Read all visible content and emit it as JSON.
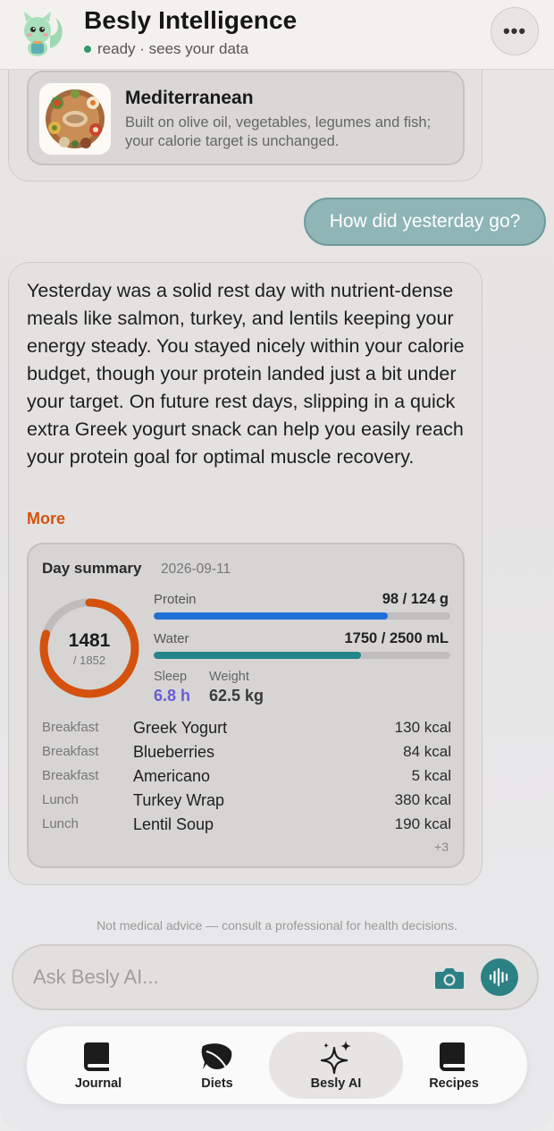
{
  "header": {
    "title": "Besly Intelligence",
    "status": "ready · sees your data",
    "menu_icon": "ellipsis-icon"
  },
  "diet_card": {
    "title": "Mediterranean",
    "description": "Built on olive oil, vegetables, legumes and fish; your calorie target is unchanged."
  },
  "user_message": "How did yesterday go?",
  "assistant_message": {
    "text": "Yesterday was a solid rest day with nutrient-dense meals like salmon, turkey, and lentils keeping your energy steady. You stayed nicely within your calorie budget, though your protein landed just a bit under your target. On future rest days, slipping in a quick extra Greek yogurt snack can help you easily reach your protein goal for optimal muscle recovery.",
    "more_label": "More"
  },
  "day_summary": {
    "title": "Day summary",
    "date": "2026-09-11",
    "calories": "1481",
    "calorie_goal": "/ 1852",
    "calorie_fraction": 0.8,
    "protein_label": "Protein",
    "protein_value": "98 / 124 g",
    "protein_fraction": 0.79,
    "water_label": "Water",
    "water_value": "1750 / 2500 mL",
    "water_fraction": 0.7,
    "sleep_label": "Sleep",
    "sleep_value": "6.8 h",
    "weight_label": "Weight",
    "weight_value": "62.5 kg",
    "meals": [
      {
        "type": "Breakfast",
        "name": "Greek Yogurt",
        "kcal": "130 kcal"
      },
      {
        "type": "Breakfast",
        "name": "Blueberries",
        "kcal": "84 kcal"
      },
      {
        "type": "Breakfast",
        "name": "Americano",
        "kcal": "5 kcal"
      },
      {
        "type": "Lunch",
        "name": "Turkey Wrap",
        "kcal": "380 kcal"
      },
      {
        "type": "Lunch",
        "name": "Lentil Soup",
        "kcal": "190 kcal"
      }
    ],
    "more_count": "+3"
  },
  "disclaimer": "Not medical advice — consult a professional for health decisions.",
  "input": {
    "placeholder": "Ask Besly AI..."
  },
  "tabs": [
    {
      "label": "Journal",
      "icon": "book-icon"
    },
    {
      "label": "Diets",
      "icon": "leaf-icon"
    },
    {
      "label": "Besly AI",
      "icon": "sparkles-icon"
    },
    {
      "label": "Recipes",
      "icon": "recipe-book-icon"
    }
  ],
  "colors": {
    "accent_orange": "#d4520e",
    "protein_bar": "#1f6fd6",
    "water_bar": "#23868a",
    "sleep_text": "#6a5bd6",
    "user_bubble": "#8fb5b6",
    "voice_button": "#2c8185"
  }
}
